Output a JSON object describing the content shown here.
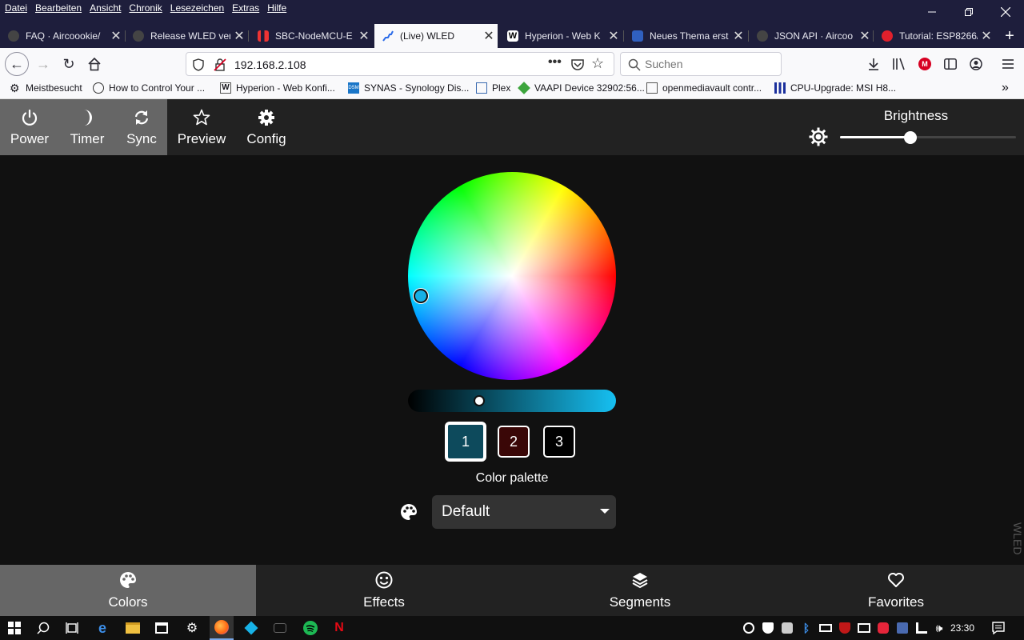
{
  "browser": {
    "menu": [
      "Datei",
      "Bearbeiten",
      "Ansicht",
      "Chronik",
      "Lesezeichen",
      "Extras",
      "Hilfe"
    ],
    "tabs": [
      {
        "title": "FAQ · Aircoookie/",
        "icon": "github-icon"
      },
      {
        "title": "Release WLED ver",
        "icon": "github-icon"
      },
      {
        "title": "SBC-NodeMCU-E",
        "icon": "pdf-icon"
      },
      {
        "title": "(Live) WLED",
        "icon": "wled-icon",
        "active": true
      },
      {
        "title": "Hyperion - Web K",
        "icon": "wiki-icon"
      },
      {
        "title": "Neues Thema erst",
        "icon": "forum-icon"
      },
      {
        "title": "JSON API · Aircoo",
        "icon": "github-icon"
      },
      {
        "title": "Tutorial: ESP8266/",
        "icon": "tutorial-icon"
      }
    ],
    "url": "192.168.2.108",
    "search_placeholder": "Suchen",
    "bookmarks": [
      "Meistbesucht",
      "How to Control Your ...",
      "Hyperion - Web Konfi...",
      "SYNAS - Synology Dis...",
      "Plex",
      "VAAPI Device 32902:56...",
      "openmediavault contr...",
      "CPU-Upgrade: MSI H8..."
    ]
  },
  "wled": {
    "top_nav": {
      "power": "Power",
      "timer": "Timer",
      "sync": "Sync",
      "preview": "Preview",
      "config": "Config"
    },
    "brightness": {
      "label": "Brightness",
      "value": 0.4
    },
    "color_slots": [
      "1",
      "2",
      "3"
    ],
    "slot_colors": [
      "#0d4a5c",
      "#3a0707",
      "#000000"
    ],
    "selected_slot": 0,
    "palette_label": "Color palette",
    "palette_value": "Default",
    "brand_tag": "WLED",
    "bottom_nav": {
      "colors": "Colors",
      "effects": "Effects",
      "segments": "Segments",
      "favorites": "Favorites"
    }
  },
  "taskbar": {
    "clock": "23:30"
  }
}
